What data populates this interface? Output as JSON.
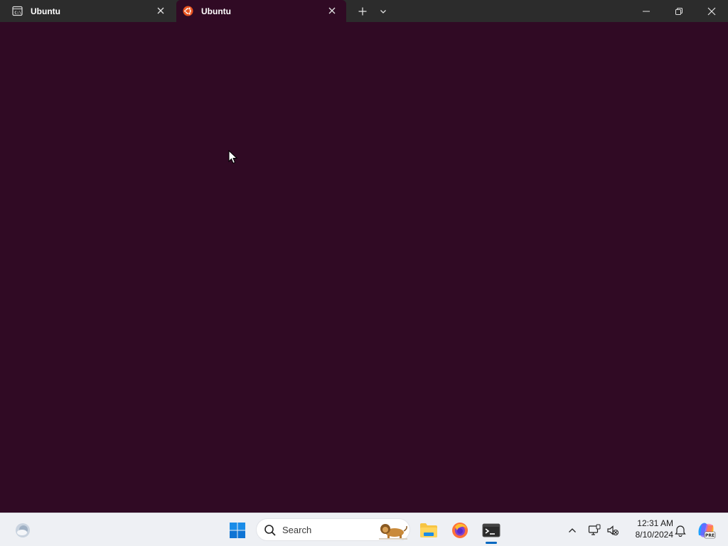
{
  "window": {
    "tabs": [
      {
        "label": "Ubuntu",
        "icon": "console-icon",
        "active": false
      },
      {
        "label": "Ubuntu",
        "icon": "ubuntu-logo-icon",
        "active": true
      }
    ],
    "controls": [
      "new-tab",
      "tab-dropdown",
      "minimize",
      "restore",
      "close"
    ],
    "terminal_background": "#300a24",
    "titlebar_background": "#2c2c2c"
  },
  "taskbar": {
    "search": {
      "placeholder": "Search"
    },
    "pinned": [
      "widgets-weather-icon",
      "start-icon",
      "file-explorer-icon",
      "firefox-icon",
      "terminal-icon"
    ],
    "active_app": "terminal-icon",
    "tray": [
      "chevron-up-icon",
      "network-icon",
      "volume-muted-icon",
      "notification-bell-icon",
      "copilot-icon"
    ],
    "clock": {
      "time": "12:31 AM",
      "date": "8/10/2024"
    },
    "copilot_badge": "PRE"
  }
}
